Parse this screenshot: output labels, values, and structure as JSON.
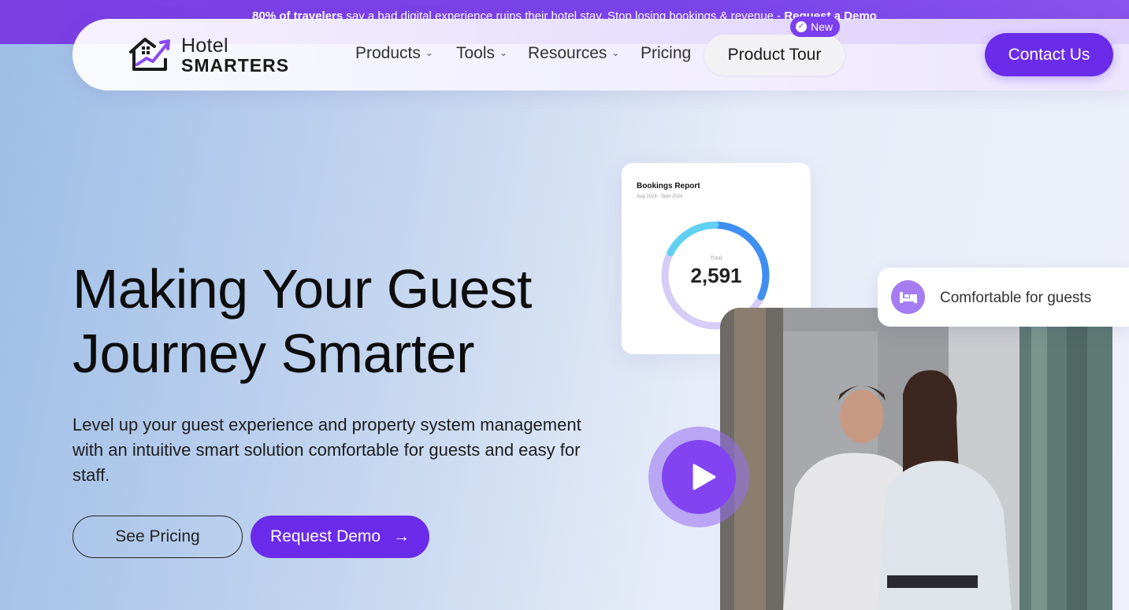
{
  "announcement": {
    "bold_lead": "80% of travelers",
    "text": " say a bad digital experience ruins their hotel stay. Stop losing bookings & revenue - ",
    "link": "Request a Demo"
  },
  "logo": {
    "word1": "Hotel",
    "word2": "SMARTERS",
    "icon": "house-chart-icon"
  },
  "nav": {
    "items": [
      {
        "label": "Products",
        "has_dropdown": true
      },
      {
        "label": "Tools",
        "has_dropdown": true
      },
      {
        "label": "Resources",
        "has_dropdown": true
      },
      {
        "label": "Pricing",
        "has_dropdown": false
      }
    ],
    "tour_label": "Product Tour",
    "new_badge": "New",
    "contact_label": "Contact Us"
  },
  "hero": {
    "title_line1": "Making Your Guest",
    "title_line2": "Journey Smarter",
    "subtitle": "Level up your guest experience and property system management with an intuitive smart solution comfortable for guests and easy for staff.",
    "secondary_cta": "See Pricing",
    "primary_cta": "Request Demo",
    "primary_cta_icon": "arrow-right-icon"
  },
  "report": {
    "title": "Bookings Report",
    "date_range": "Aug 2024 - Sept 2024",
    "total_label": "Total",
    "total_value": "2,591"
  },
  "comfort": {
    "label": "Comfortable for guests",
    "icon": "bed-icon"
  },
  "colors": {
    "brand_purple": "#6a2bea",
    "announce_purple": "#7b3fe4",
    "donut_blue": "#3f8ef2",
    "donut_cyan": "#5fd0f0",
    "donut_lavender": "#d5cdf6"
  }
}
